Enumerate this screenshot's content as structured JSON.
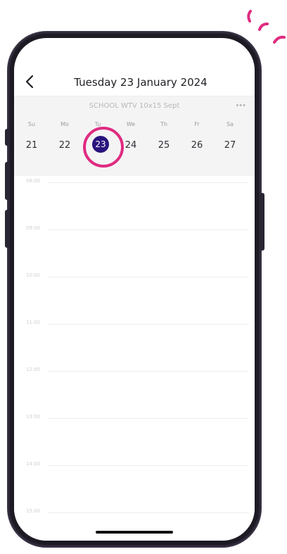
{
  "header": {
    "title": "Tuesday 23 January 2024"
  },
  "calendar": {
    "name": "SCHOOL WTV 10x15 Sept",
    "weekdays": [
      "Su",
      "Mo",
      "Tu",
      "We",
      "Th",
      "Fr",
      "Sa"
    ],
    "dates": [
      "21",
      "22",
      "23",
      "24",
      "25",
      "26",
      "27"
    ],
    "selected_index": 2,
    "more_glyph": "•••"
  },
  "timeline": {
    "times": [
      "08:00",
      "09:00",
      "10:00",
      "11:00",
      "12:00",
      "13:00",
      "14:00",
      "15:00"
    ]
  },
  "icons": {
    "back": "back-chevron-icon",
    "more": "more-horizontal-icon"
  },
  "colors": {
    "accent": "#DF2B80",
    "selected_day": "#29137D",
    "screen_background": "#FFFFFF",
    "calendar_band": "#F4F4F5",
    "phone_frame": "#1D1A24"
  }
}
